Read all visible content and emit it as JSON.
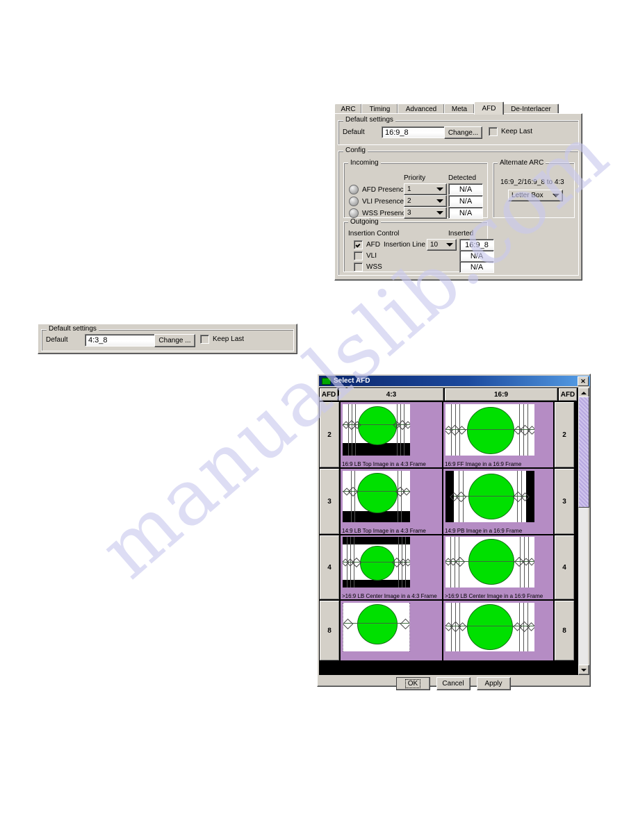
{
  "watermark": {
    "text": "manualslib.com"
  },
  "afd_tab_dialog": {
    "tabs": [
      {
        "label": "ARC",
        "selected": false
      },
      {
        "label": "Timing",
        "selected": false
      },
      {
        "label": "Advanced",
        "selected": false
      },
      {
        "label": "Meta",
        "selected": false
      },
      {
        "label": "AFD",
        "selected": true
      },
      {
        "label": "De-Interlacer",
        "selected": false
      }
    ],
    "default_settings": {
      "legend": "Default settings",
      "default_label": "Default",
      "default_value": "16:9_8",
      "change_button": "Change...",
      "keep_last_label": "Keep Last",
      "keep_last_checked": false
    },
    "config": {
      "legend": "Config",
      "incoming": {
        "legend": "Incoming",
        "col_priority": "Priority",
        "col_detected": "Detected",
        "rows": [
          {
            "name": "AFD Presence",
            "priority": "1",
            "detected": "N/A"
          },
          {
            "name": "VLI Presence",
            "priority": "2",
            "detected": "N/A"
          },
          {
            "name": "WSS Presence",
            "priority": "3",
            "detected": "N/A"
          }
        ]
      },
      "alternate_arc": {
        "legend": "Alternate ARC",
        "conversion": "16:9_2/16:9_8 to 4:3",
        "mode": "Letter Box"
      },
      "outgoing": {
        "legend": "Outgoing",
        "insertion_control_label": "Insertion Control",
        "inserted_label": "Inserted",
        "insertion_line_label": "Insertion Line",
        "insertion_line_value": "10",
        "rows": [
          {
            "name": "AFD",
            "checked": true,
            "inserted": "16:9_8"
          },
          {
            "name": "VLI",
            "checked": false,
            "inserted": "N/A"
          },
          {
            "name": "WSS",
            "checked": false,
            "inserted": "N/A"
          }
        ]
      }
    }
  },
  "default_settings_panel": {
    "legend": "Default settings",
    "default_label": "Default",
    "default_value": "4:3_8",
    "change_button": "Change ...",
    "keep_last_label": "Keep Last",
    "keep_last_checked": false
  },
  "select_afd_dialog": {
    "title": "Select AFD",
    "close_label": "✕",
    "header": {
      "left_afd": "AFD",
      "col_4_3": "4:3",
      "col_16_9": "16:9",
      "right_afd": "AFD"
    },
    "rows": [
      {
        "code": "2",
        "left": {
          "caption": "16:9 LB Top Image in a 4:3 Frame",
          "frame": "4:3",
          "mode": "lb-top"
        },
        "right": {
          "caption": "16:9 FF Image in a 16:9 Frame",
          "frame": "16:9",
          "mode": "ff"
        }
      },
      {
        "code": "3",
        "left": {
          "caption": "14:9 LB Top Image in a 4:3 Frame",
          "frame": "4:3",
          "mode": "lb-top"
        },
        "right": {
          "caption": "14:9 PB Image in a 16:9 Frame",
          "frame": "16:9",
          "mode": "pillar"
        }
      },
      {
        "code": "4",
        "left": {
          "caption": ">16:9 LB Center Image in a 4:3 Frame",
          "frame": "4:3",
          "mode": "lb-center"
        },
        "right": {
          "caption": ">16:9 LB Center Image in a 16:9 Frame",
          "frame": "16:9",
          "mode": "lb-center-wide"
        }
      },
      {
        "code": "8",
        "left": {
          "caption": "",
          "frame": "4:3",
          "mode": "ff-narrow"
        },
        "right": {
          "caption": "",
          "frame": "16:9",
          "mode": "ff"
        }
      }
    ],
    "buttons": [
      {
        "label": "OK",
        "default": true
      },
      {
        "label": "Cancel",
        "default": false
      },
      {
        "label": "Apply",
        "default": false
      }
    ],
    "scrollbar": {
      "up": "▲",
      "down": "▼"
    }
  },
  "colors": {
    "face": "#d4d0c8",
    "cell_background": "#b58cc4",
    "pattern_green": "#00e000",
    "titlebar_start": "#0a246a",
    "titlebar_end": "#57a0e8"
  }
}
